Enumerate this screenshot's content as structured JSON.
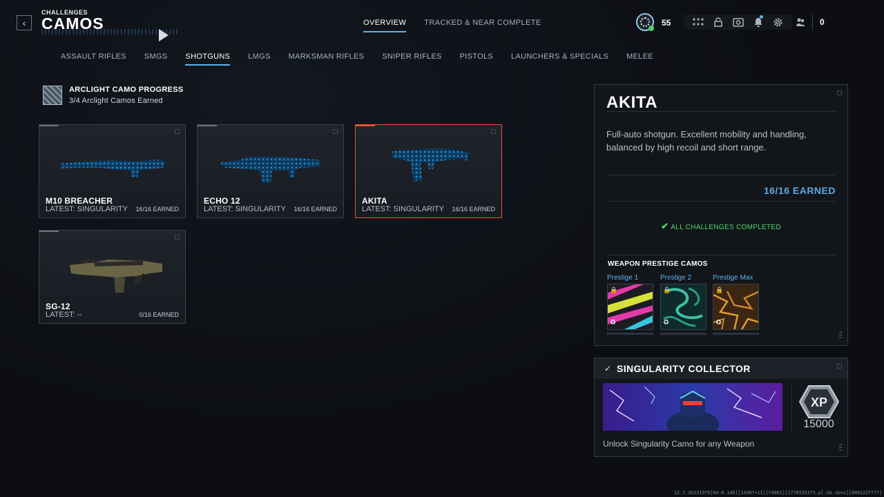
{
  "header": {
    "crumb": "CHALLENGES",
    "title": "CAMOS",
    "tabs": [
      {
        "label": "OVERVIEW",
        "active": true
      },
      {
        "label": "TRACKED & NEAR COMPLETE",
        "active": false
      }
    ],
    "player_level": "55",
    "friend_count": "0",
    "icons": [
      "apps-grid-icon",
      "store-lock-icon",
      "camera-icon",
      "notification-bell-icon",
      "gear-icon",
      "friends-icon"
    ]
  },
  "categories": [
    {
      "label": "ASSAULT RIFLES",
      "active": false
    },
    {
      "label": "SMGS",
      "active": false
    },
    {
      "label": "SHOTGUNS",
      "active": true
    },
    {
      "label": "LMGS",
      "active": false
    },
    {
      "label": "MARKSMAN RIFLES",
      "active": false
    },
    {
      "label": "SNIPER RIFLES",
      "active": false
    },
    {
      "label": "PISTOLS",
      "active": false
    },
    {
      "label": "LAUNCHERS & SPECIALS",
      "active": false
    },
    {
      "label": "MELEE",
      "active": false
    }
  ],
  "arclight": {
    "title": "ARCLIGHT CAMO PROGRESS",
    "subtitle": "3/4 Arclight Camos Earned"
  },
  "weapons": [
    {
      "name": "M10 BREACHER",
      "latest": "LATEST: SINGULARITY",
      "earned": "16/16 EARNED",
      "camo": "singularity",
      "selected": false
    },
    {
      "name": "ECHO 12",
      "latest": "LATEST: SINGULARITY",
      "earned": "16/16 EARNED",
      "camo": "singularity",
      "selected": false
    },
    {
      "name": "AKITA",
      "latest": "LATEST: SINGULARITY",
      "earned": "16/16 EARNED",
      "camo": "singularity",
      "selected": true
    },
    {
      "name": "SG-12",
      "latest": "LATEST: --",
      "earned": "0/16 EARNED",
      "camo": "none",
      "selected": false
    }
  ],
  "detail": {
    "name": "AKITA",
    "description": "Full-auto shotgun. Excellent mobility and handling, balanced by high recoil and short range.",
    "earned": "16/16 EARNED",
    "status": "ALL CHALLENGES COMPLETED",
    "status_color": "#4ddb6a",
    "prestige_title": "WEAPON PRESTIGE CAMOS",
    "prestige": [
      {
        "label": "Prestige 1",
        "locked": true
      },
      {
        "label": "Prestige 2",
        "locked": true
      },
      {
        "label": "Prestige Max",
        "locked": true
      }
    ]
  },
  "collector": {
    "title": "SINGULARITY COLLECTOR",
    "reward_xp": "15000",
    "description": "Unlock Singularity Camo for any Weapon"
  },
  "build_string": "12.7.26331976[60-0.146][10407+11][74001][1776535373.pl.Ga.xbsx][000122ffff]",
  "colors": {
    "accent": "#5fb6e8",
    "selected_border": "#e4572e",
    "complete_green": "#4ddb6a",
    "earned_blue": "#5da8e4"
  }
}
